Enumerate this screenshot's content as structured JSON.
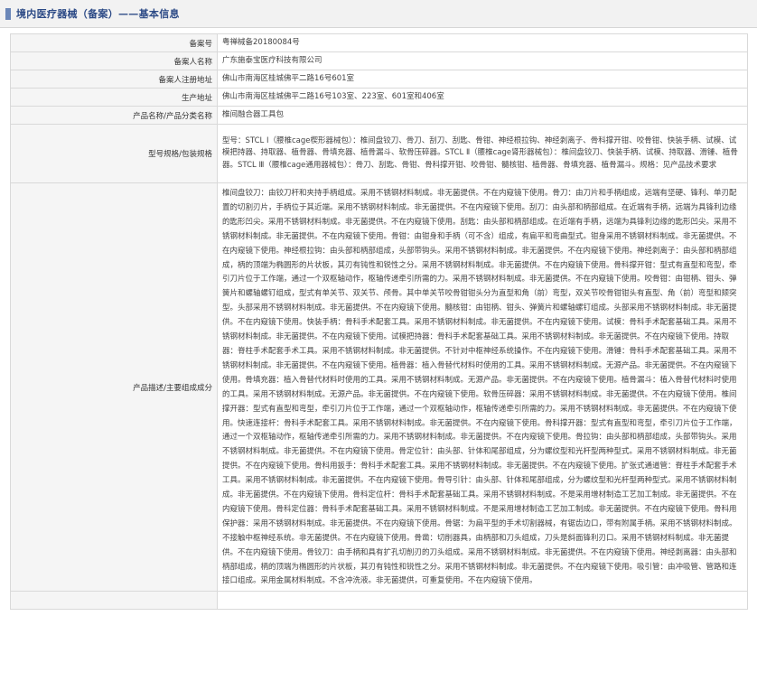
{
  "header": {
    "title": "境内医疗器械（备案）——基本信息"
  },
  "rows": [
    {
      "label": "备案号",
      "value": "粤禅械备20180084号"
    },
    {
      "label": "备案人名称",
      "value": "广东施泰宝医疗科技有限公司"
    },
    {
      "label": "备案人注册地址",
      "value": "佛山市南海区桂城佛平二路16号601室"
    },
    {
      "label": "生产地址",
      "value": "佛山市南海区桂城佛平二路16号103室、223室、601室和406室"
    },
    {
      "label": "产品名称/产品分类名称",
      "value": "椎间融合器工具包"
    },
    {
      "label": "型号规格/包装规格",
      "value": "型号：STCL Ⅰ（腰椎cage楔形器械包）：椎间盘铰刀、骨刀、刮刀、刮匙、骨钳、神经根拉钩、神经剥离子、骨科撑开钳、咬骨钳、快装手柄、试模、试模把持器、持取器、植骨器、骨填充器、植骨漏斗、软骨压碎器。STCL Ⅱ（腰椎cage肾形器械包）：椎间盘铰刀、快装手柄、试模、持取器、滑锤、植骨器。STCL Ⅲ（腰椎cage通用器械包）：骨刀、刮匙、骨钳、骨科撑开钳、咬骨钳、髓核钳、植骨器、骨填充器、植骨漏斗。规格：见产品技术要求"
    },
    {
      "label": "产品描述/主要组成成分",
      "value": "椎间盘铰刀：由铰刀杆和夹持手柄组成。采用不锈钢材料制成。非无菌提供。不在内窥镜下使用。骨刀：由刀片和手柄组成，远端有坚硬、锋利、单刃配置的切割刃片，手柄位于其近端。采用不锈钢材料制成。非无菌提供。不在内窥镜下使用。刮刀：由头部和柄部组成。在近端有手柄，远端为具锋利边缘的匙形凹尖。采用不锈钢材料制成。非无菌提供。不在内窥镜下使用。刮匙：由头部和柄部组成。在近端有手柄，远端为具锋利边缘的匙形凹尖。采用不锈钢材料制成。非无菌提供。不在内窥镜下使用。骨钳：由钳身和手柄（可不含）组成，有扁平和弯曲型式。钳身采用不锈钢材料制成。非无菌提供。不在内窥镜下使用。神经根拉钩：由头部和柄部组成，头部带钩头。采用不锈钢材料制成。非无菌提供。不在内窥镜下使用。神经剥离子：由头部和柄部组成，柄的顶端为椭圆形的片状板，其刃有钝性和锐性之分。采用不锈钢材料制成。非无菌提供。不在内窥镜下使用。骨科撑开钳：型式有直型和弯型，牵引刀片位于工作端，通过一个双枢轴动作，枢轴传递牵引所需的力。采用不锈钢材料制成。非无菌提供。不在内窥镜下使用。咬骨钳：由钳柄、钳头、弹簧片和螺轴螺钉组成，型式有单关节、双关节、颅骨。其中单关节咬骨钳钳头分为直型和角（前）弯型，双关节咬骨钳钳头有直型、角（前）弯型和颏突型。头部采用不锈钢材料制成。非无菌提供。不在内窥镜下使用。髓核钳：由钳柄、钳头、弹簧片和螺轴螺钉组成。头部采用不锈钢材料制成。非无菌提供。不在内窥镜下使用。快装手柄：骨科手术配套工具。采用不锈钢材料制成。非无菌提供。不在内窥镜下使用。试模：骨科手术配套基础工具。采用不锈钢材料制成。非无菌提供。不在内窥镜下使用。试模把持器：骨科手术配套基础工具。采用不锈钢材料制成。非无菌提供。不在内窥镜下使用。持取器：脊柱手术配套手术工具。采用不锈钢材料制成。非无菌提供。不针对中枢神经系统操作。不在内窥镜下使用。滑锤：骨科手术配套基础工具。采用不锈钢材料制成。非无菌提供。不在内窥镜下使用。植骨器：植入骨替代材料时使用的工具。采用不锈钢材料制成。无源产品。非无菌提供。不在内窥镜下使用。骨填充器：植入骨替代材料时使用的工具。采用不锈钢材料制成。无源产品。非无菌提供。不在内窥镜下使用。植骨漏斗：植入骨替代材料时使用的工具。采用不锈钢材料制成。无源产品。非无菌提供。不在内窥镜下使用。软骨压碎器：采用不锈钢材料制成。非无菌提供。不在内窥镜下使用。椎间撑开器：型式有直型和弯型，牵引刀片位于工作端，通过一个双枢轴动作，枢轴传递牵引所需的力。采用不锈钢材料制成。非无菌提供。不在内窥镜下使用。快速连接杆：骨科手术配套工具。采用不锈钢材料制成。非无菌提供。不在内窥镜下使用。骨科撑开器：型式有直型和弯型，牵引刀片位于工作端，通过一个双枢轴动作，枢轴传递牵引所需的力。采用不锈钢材料制成。非无菌提供。不在内窥镜下使用。骨拉钩：由头部和柄部组成，头部带钩头。采用不锈钢材料制成。非无菌提供。不在内窥镜下使用。骨定位针：由头部、针体和尾部组成，分为螺纹型和光杆型两种型式。采用不锈钢材料制成。非无菌提供。不在内窥镜下使用。骨科用扳手：骨科手术配套工具。采用不锈钢材料制成。非无菌提供。不在内窥镜下使用。扩张式通道管：脊柱手术配套手术工具。采用不锈钢材料制成。非无菌提供。不在内窥镜下使用。骨导引针：由头部、针体和尾部组成，分为螺纹型和光杆型两种型式。采用不锈钢材料制成。非无菌提供。不在内窥镜下使用。骨科定位杆：骨科手术配套基础工具。采用不锈钢材料制成。不是采用增材制造工艺加工制成。非无菌提供。不在内窥镜下使用。骨科定位器：骨科手术配套基础工具。采用不锈钢材料制成。不是采用增材制造工艺加工制成。非无菌提供。不在内窥镜下使用。骨科用保护器：采用不锈钢材料制成。非无菌提供。不在内窥镜下使用。骨锯：为扁平型的手术切割器械，有锯齿边口，带有附属手柄。采用不锈钢材料制成。不接触中枢神经系统。非无菌提供。不在内窥镜下使用。骨凿：切削器具，由柄部和刀头组成，刀头是斜面锋利刃口。采用不锈钢材料制成。非无菌提供。不在内窥镜下使用。骨铰刀：由手柄和具有扩孔切削刃的刀头组成。采用不锈钢材料制成。非无菌提供。不在内窥镜下使用。神经剥离器：由头部和柄部组成，柄的顶端为椭圆形的片状板，其刃有钝性和锐性之分。采用不锈钢材料制成。非无菌提供。不在内窥镜下使用。吸引管：由冲吸管、管路和连接口组成。采用金属材料制成。不含冲洗液。非无菌提供，可重复使用。不在内窥镜下使用。"
    },
    {
      "label": "",
      "value": ""
    }
  ]
}
